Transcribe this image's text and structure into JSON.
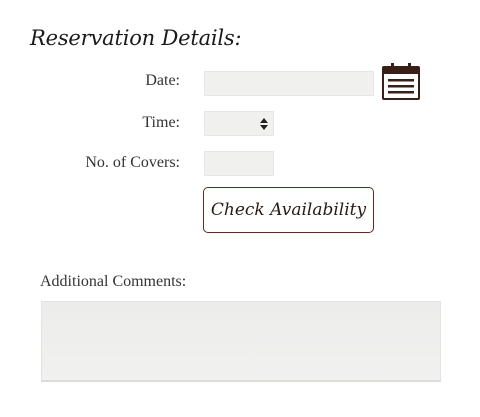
{
  "form": {
    "title": "Reservation Details:",
    "date_label": "Date:",
    "date_value": "",
    "time_label": "Time:",
    "time_value": "",
    "covers_label": "No. of Covers:",
    "covers_value": "",
    "check_button_label": "Check Availability",
    "comments_label": "Additional Comments:",
    "comments_value": ""
  },
  "icons": {
    "calendar": "calendar-icon",
    "select_arrows": "up-down-arrows-icon"
  },
  "colors": {
    "accent": "#5a2e22",
    "field_background": "#f0f0ef",
    "text": "#333333"
  }
}
